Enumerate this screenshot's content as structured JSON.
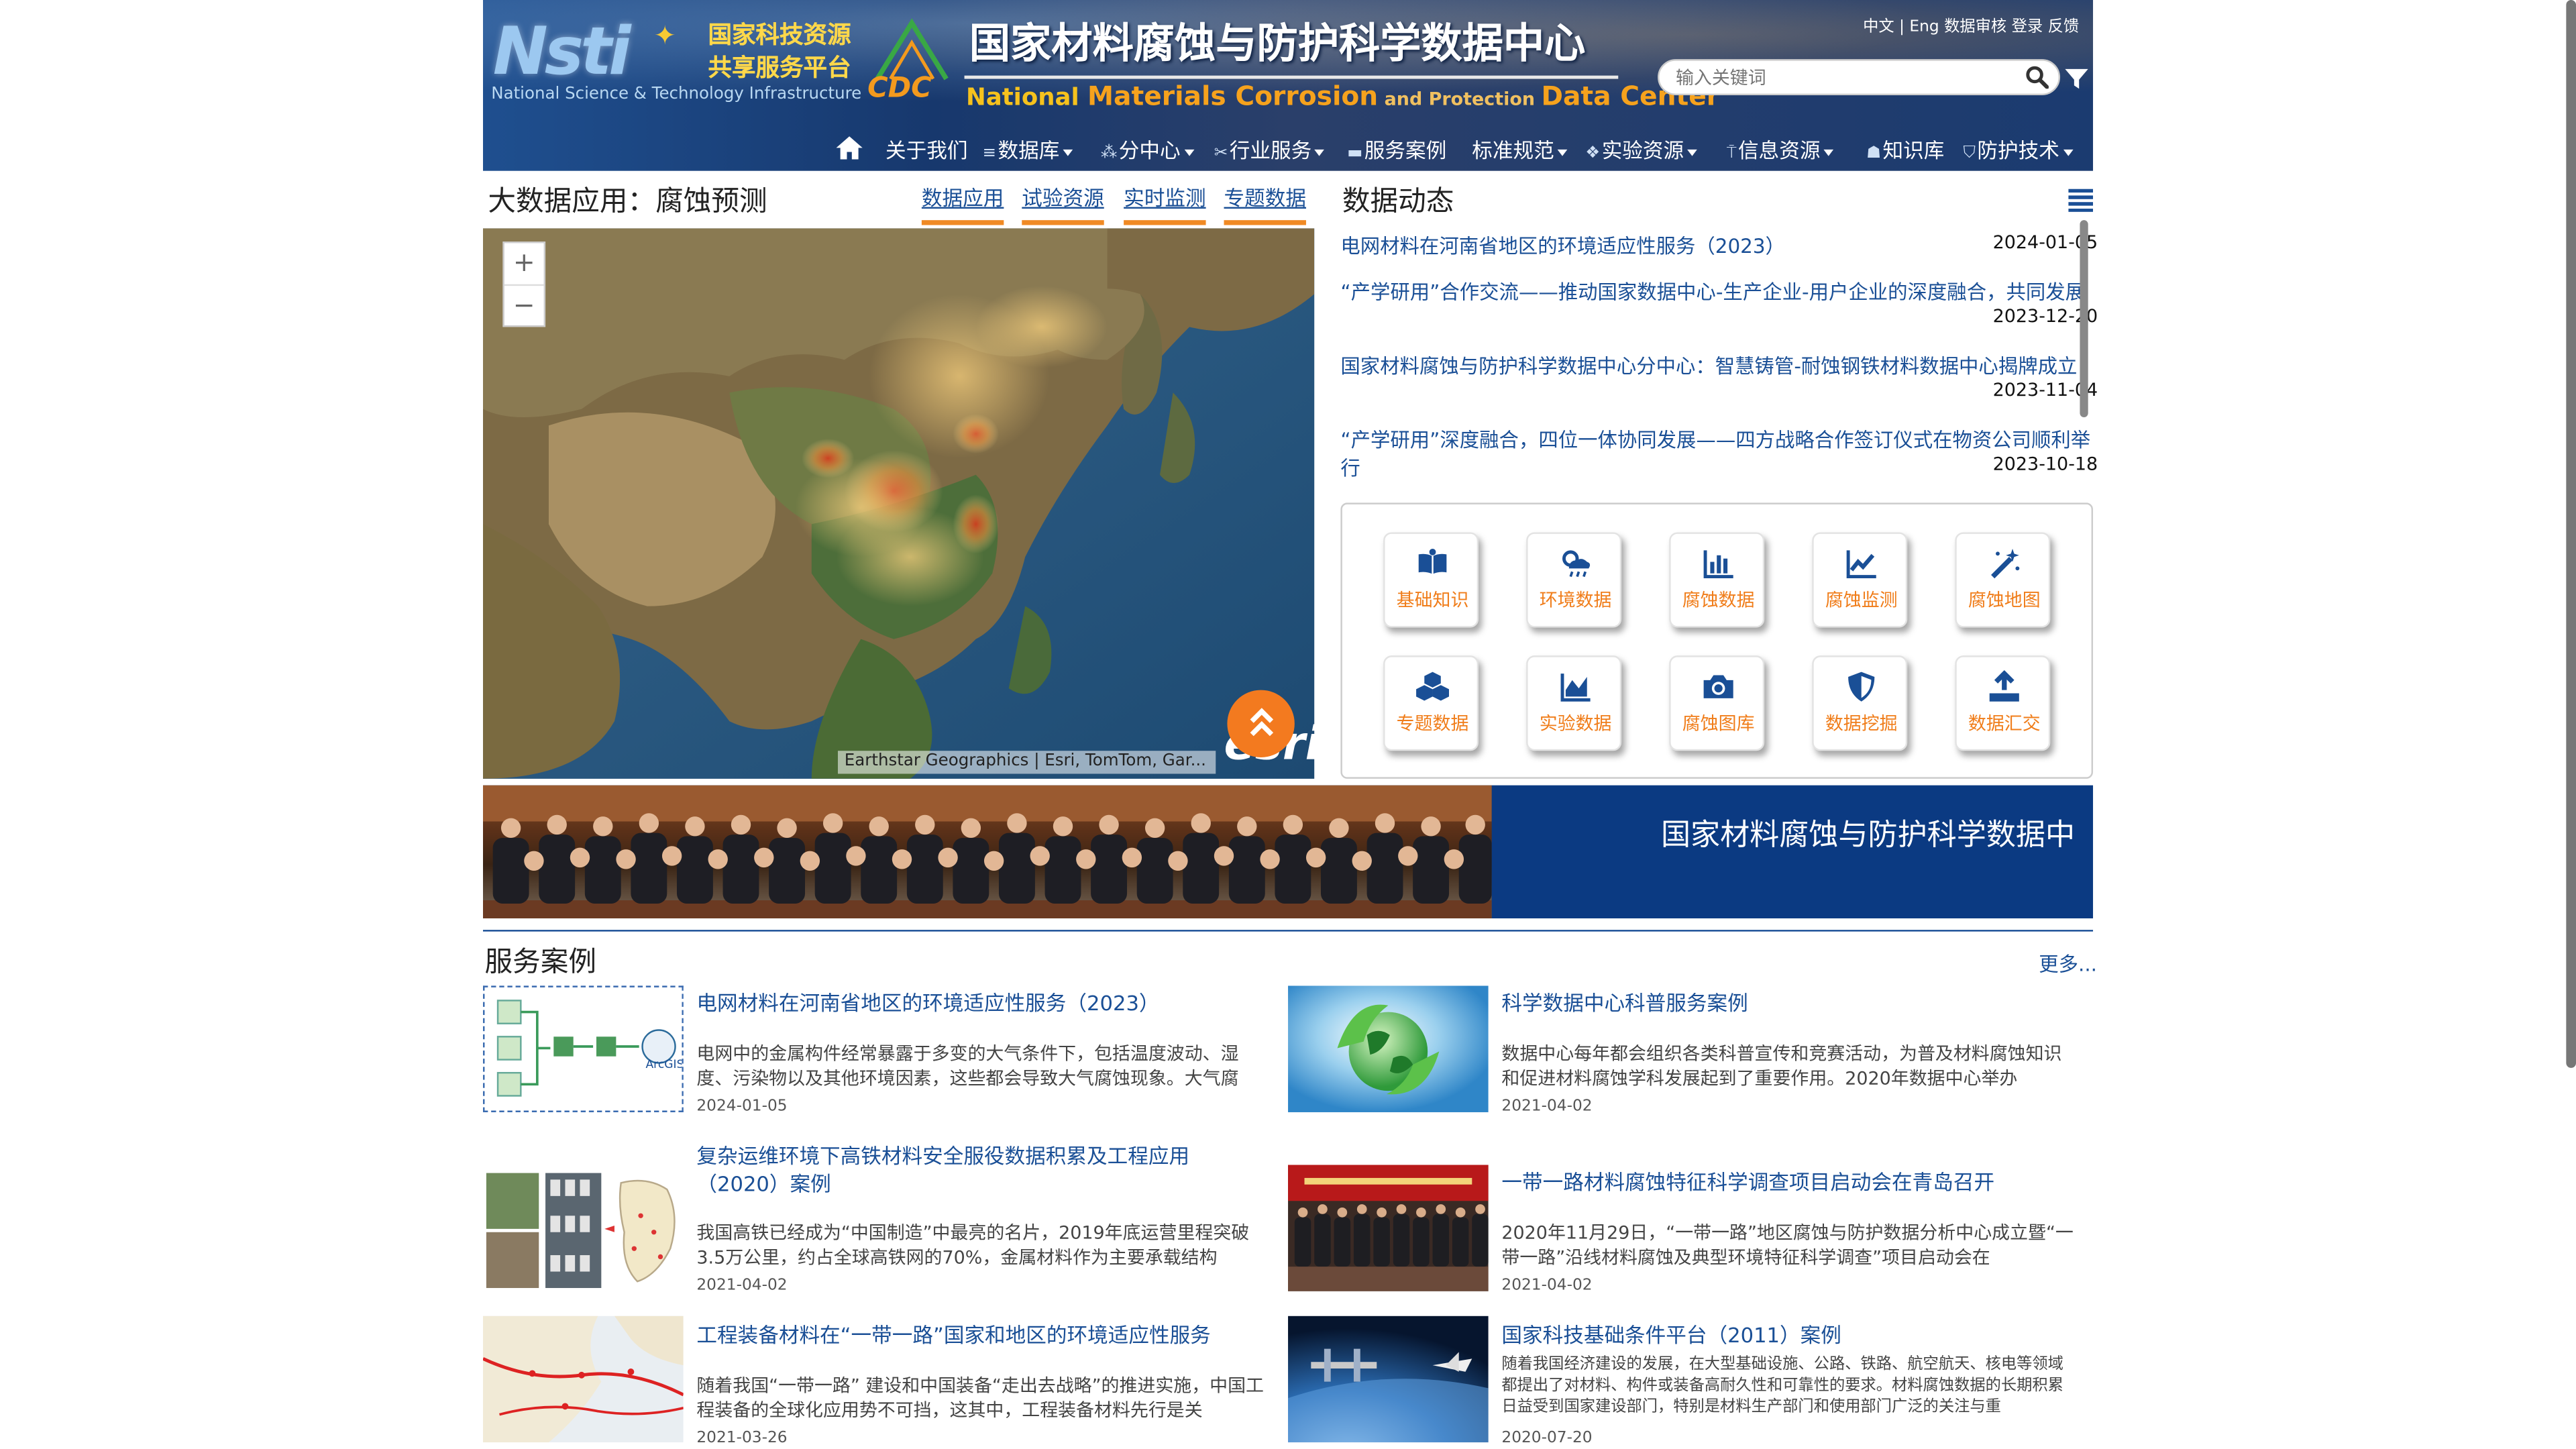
{
  "header": {
    "logo_abbr": "Nsti",
    "logo_line1": "国家科技资源",
    "logo_line2": "共享服务平台",
    "logo_en": "National Science & Technology Infrastructure",
    "cdc_abbr": "CDC",
    "title_cn": "国家材料腐蚀与防护科学数据中心",
    "title_en_1": "National ",
    "title_en_2": "Materials Corrosion",
    "title_en_3": " and Protection ",
    "title_en_4": "Data Center",
    "toplinks": [
      "中文",
      "|",
      "Eng",
      "数据审核",
      "登录",
      "反馈"
    ],
    "search_placeholder": "输入关键词"
  },
  "nav": [
    {
      "label": "关于我们",
      "icon": "",
      "dropdown": false
    },
    {
      "label": "数据库",
      "icon": "database-icon",
      "dropdown": true
    },
    {
      "label": "分中心",
      "icon": "sitemap-icon",
      "dropdown": true
    },
    {
      "label": "行业服务",
      "icon": "tools-icon",
      "dropdown": true
    },
    {
      "label": "服务案例",
      "icon": "card-icon",
      "dropdown": false
    },
    {
      "label": "标准规范",
      "icon": "",
      "dropdown": true
    },
    {
      "label": "实验资源",
      "icon": "cubes-icon",
      "dropdown": true
    },
    {
      "label": "信息资源",
      "icon": "antenna-icon",
      "dropdown": true
    },
    {
      "label": "知识库",
      "icon": "user-icon",
      "dropdown": false
    },
    {
      "label": "防护技术",
      "icon": "shield-icon",
      "dropdown": true
    }
  ],
  "bigdata": {
    "title": "大数据应用：腐蚀预测",
    "tabs": [
      "数据应用",
      "试验资源",
      "实时监测",
      "专题数据"
    ],
    "map_attribution": "Earthstar Geographics | Esri, TomTom, Gar...",
    "esri_logo": "esri",
    "zoom_in": "+",
    "zoom_out": "−"
  },
  "news": {
    "title": "数据动态",
    "items": [
      {
        "title": "电网材料在河南省地区的环境适应性服务（2023）",
        "date": "2024-01-05"
      },
      {
        "title": "“产学研用”合作交流——推动国家数据中心-生产企业-用户企业的深度融合，共同发展",
        "date": "2023-12-20"
      },
      {
        "title": "国家材料腐蚀与防护科学数据中心分中心：智慧铸管-耐蚀钢铁材料数据中心揭牌成立",
        "date": "2023-11-04"
      },
      {
        "title": "“产学研用”深度融合，四位一体协同发展——四方战略合作签订仪式在物资公司顺利举行",
        "date": "2023-10-18"
      }
    ]
  },
  "quick_links": [
    {
      "label": "基础知识",
      "icon": "book-icon"
    },
    {
      "label": "环境数据",
      "icon": "weather-icon"
    },
    {
      "label": "腐蚀数据",
      "icon": "bar-chart-icon"
    },
    {
      "label": "腐蚀监测",
      "icon": "line-chart-icon"
    },
    {
      "label": "腐蚀地图",
      "icon": "magic-wand-icon"
    },
    {
      "label": "专题数据",
      "icon": "cubes-icon"
    },
    {
      "label": "实验数据",
      "icon": "area-chart-icon"
    },
    {
      "label": "腐蚀图库",
      "icon": "camera-icon"
    },
    {
      "label": "数据挖掘",
      "icon": "shield-icon"
    },
    {
      "label": "数据汇交",
      "icon": "upload-icon"
    }
  ],
  "banner": {
    "text": "国家材料腐蚀与防护科学数据中"
  },
  "service_cases": {
    "title": "服务案例",
    "more": "更多...",
    "items": [
      {
        "title": "电网材料在河南省地区的环境适应性服务（2023）",
        "desc": "电网中的金属构件经常暴露于多变的大气条件下，包括温度波动、湿度、污染物以及其他环境因素，这些都会导致大气腐蚀现象。大气腐",
        "date": "2024-01-05"
      },
      {
        "title": "科学数据中心科普服务案例",
        "desc": "数据中心每年都会组织各类科普宣传和竞赛活动，为普及材料腐蚀知识和促进材料腐蚀学科发展起到了重要作用。2020年数据中心举办",
        "date": "2021-04-02"
      },
      {
        "title": "复杂运维环境下高铁材料安全服役数据积累及工程应用（2020）案例",
        "desc": "我国高铁已经成为“中国制造”中最亮的名片，2019年底运营里程突破3.5万公里，约占全球高铁网的70%，金属材料作为主要承载结构",
        "date": "2021-04-02"
      },
      {
        "title": "一带一路材料腐蚀特征科学调查项目启动会在青岛召开",
        "desc": "2020年11月29日，“一带一路”地区腐蚀与防护数据分析中心成立暨“一带一路”沿线材料腐蚀及典型环境特征科学调查”项目启动会在",
        "date": "2021-04-02"
      },
      {
        "title": "工程装备材料在“一带一路”国家和地区的环境适应性服务",
        "desc": "随着我国“一带一路” 建设和中国装备“走出去战略”的推进实施，中国工程装备的全球化应用势不可挡，这其中，工程装备材料先行是关",
        "date": "2021-03-26"
      },
      {
        "title": "国家科技基础条件平台（2011）案例",
        "desc": "随着我国经济建设的发展，在大型基础设施、公路、铁路、航空航天、核电等领域都提出了对材料、构件或装备高耐久性和可靠性的要求。材料腐蚀数据的长期积累日益受到国家建设部门，特别是材料生产部门和使用部门广泛的关注与重",
        "date": "2020-07-20"
      }
    ]
  },
  "colors": {
    "link": "#1a4f96",
    "accent": "#f08a24",
    "header_bg": "#17386d",
    "banner_bg": "#0b3a82"
  }
}
